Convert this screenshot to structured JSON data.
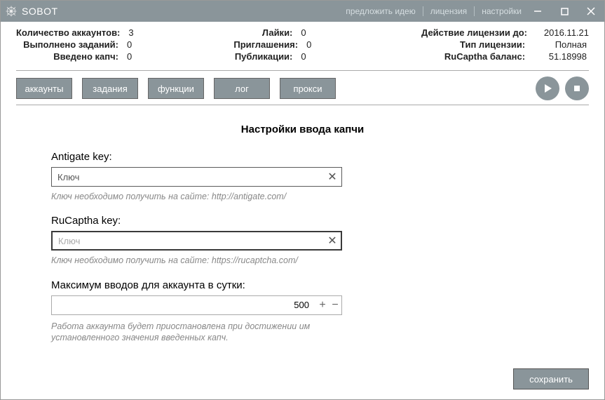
{
  "window": {
    "title": "SOBOT",
    "links": {
      "suggest": "предложить идею",
      "license": "лицензия",
      "settings": "настройки"
    }
  },
  "stats": {
    "col1": {
      "accounts_label": "Количество аккаунтов:",
      "accounts_value": "3",
      "tasks_label": "Выполнено заданий:",
      "tasks_value": "0",
      "captcha_label": "Введено капч:",
      "captcha_value": "0"
    },
    "col2": {
      "likes_label": "Лайки:",
      "likes_value": "0",
      "invites_label": "Приглашения:",
      "invites_value": "0",
      "pubs_label": "Публикации:",
      "pubs_value": "0"
    },
    "col3": {
      "lic_until_label": "Действие лицензии до:",
      "lic_until_value": "2016.11.21",
      "lic_type_label": "Тип лицензии:",
      "lic_type_value": "Полная",
      "rucap_label": "RuCaptha баланс:",
      "rucap_value": "51.18998"
    }
  },
  "tabs": {
    "accounts": "аккаунты",
    "tasks": "задания",
    "functions": "функции",
    "log": "лог",
    "proxy": "прокси"
  },
  "page": {
    "title": "Настройки ввода капчи",
    "antigate_label": "Antigate key:",
    "antigate_value": "Ключ",
    "antigate_hint": "Ключ необходимо получить на сайте: http://antigate.com/",
    "rucaptcha_label": "RuCaptha key:",
    "rucaptcha_placeholder": "Ключ",
    "rucaptcha_value": "",
    "rucaptcha_hint": "Ключ необходимо получить на сайте: https://rucaptcha.com/",
    "max_label": "Максимум вводов для аккаунта в сутки:",
    "max_value": "500",
    "max_hint": "Работа аккаунта будет приостановлена при достижении им установленного значения введенных капч."
  },
  "footer": {
    "save": "сохранить"
  }
}
